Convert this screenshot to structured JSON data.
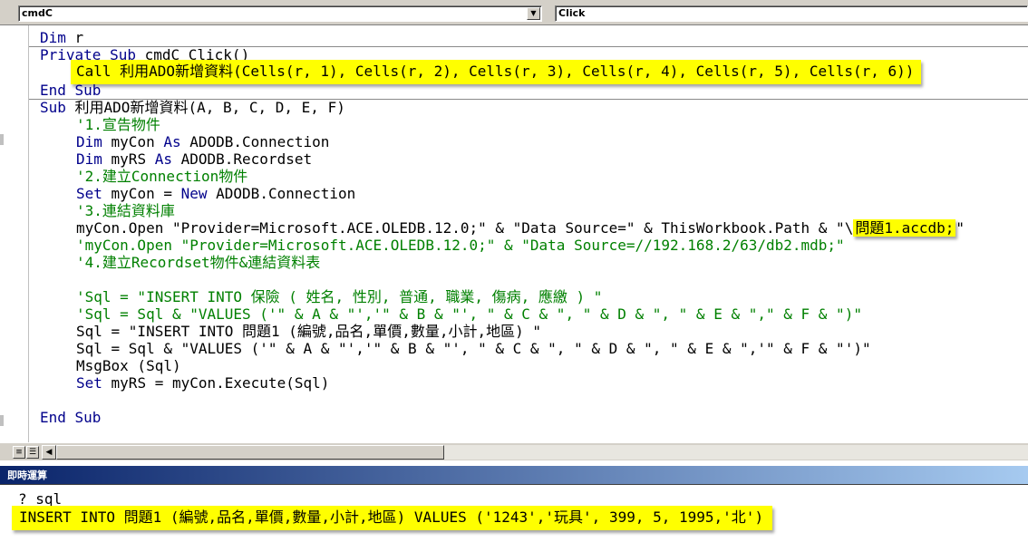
{
  "toolbar": {
    "object_combo": "cmdC",
    "procedure_combo": "Click"
  },
  "code": {
    "l1": "Dim r",
    "l2": "Private Sub cmdC_Click()",
    "l3": "Call 利用ADO新增資料(Cells(r, 1), Cells(r, 2), Cells(r, 3), Cells(r, 4), Cells(r, 5), Cells(r, 6))",
    "l4": "End Sub",
    "l5": "Sub 利用ADO新增資料(A, B, C, D, E, F)",
    "l6": "'1.宣告物件",
    "l7": "Dim myCon As ADODB.Connection",
    "l8": "Dim myRS As ADODB.Recordset",
    "l9": "'2.建立Connection物件",
    "l10": "Set myCon = New ADODB.Connection",
    "l11": "'3.連結資料庫",
    "l12a": "myCon.Open \"Provider=Microsoft.ACE.OLEDB.12.0;\" & \"Data Source=\" & ThisWorkbook.Path & \"\\",
    "l12b": "問題1.accdb;",
    "l12c": "\"",
    "l13": "'myCon.Open \"Provider=Microsoft.ACE.OLEDB.12.0;\" & \"Data Source=//192.168.2/63/db2.mdb;\"",
    "l14": "'4.建立Recordset物件&連結資料表",
    "l15": "'Sql = \"INSERT INTO 保險 ( 姓名, 性別, 普通, 職業, 傷病, 應繳 ) \"",
    "l16": "'Sql = Sql & \"VALUES ('\" & A & \"','\" & B & \"', \" & C & \", \" & D & \", \" & E & \",\" & F & \")\"",
    "l17": "Sql = \"INSERT INTO 問題1 (編號,品名,單價,數量,小計,地區) \"",
    "l18": "Sql = Sql & \"VALUES ('\" & A & \"','\" & B & \"', \" & C & \", \" & D & \", \" & E & \",'\" & F & \"')\"",
    "l19": "MsgBox (Sql)",
    "l20": "Set myRS = myCon.Execute(Sql)",
    "l21": "End Sub"
  },
  "immediate": {
    "title": "即時運算",
    "query": "? sql",
    "result": "INSERT INTO 問題1 (編號,品名,單價,數量,小計,地區) VALUES ('1243','玩具', 399, 5, 1995,'北')"
  },
  "icons": {
    "dropdown": "chevron-down-icon",
    "procedure_view": "procedure-view-icon",
    "module_view": "full-module-view-icon",
    "scroll_left": "scroll-left-icon"
  },
  "colors": {
    "keyword": "#00008b",
    "comment": "#008000",
    "highlight": "#ffff00"
  }
}
